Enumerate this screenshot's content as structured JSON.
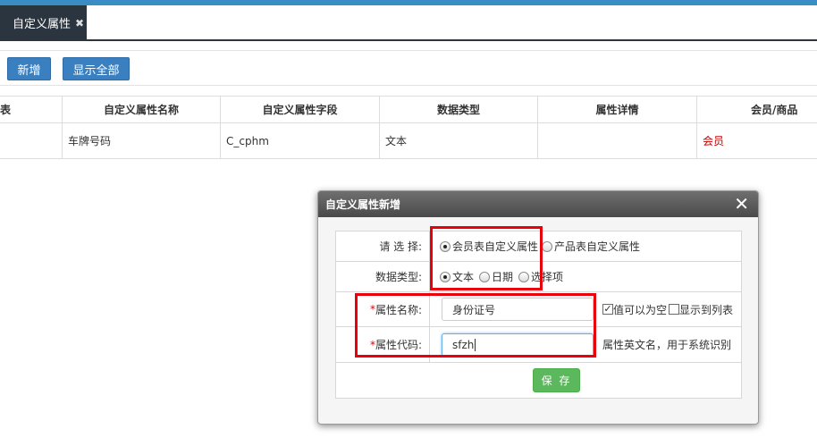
{
  "tab": {
    "label": "自定义属性",
    "close_glyph": "✖"
  },
  "toolbar": {
    "add_label": "新增",
    "show_all_label": "显示全部"
  },
  "table": {
    "columns": [
      "表",
      "自定义属性名称",
      "自定义属性字段",
      "数据类型",
      "属性详情",
      "会员/商品"
    ],
    "rows": [
      {
        "c0": "",
        "name": "车牌号码",
        "field": "C_cphm",
        "type": "文本",
        "detail": "",
        "scope": "会员"
      }
    ]
  },
  "dialog": {
    "title": "自定义属性新增",
    "close_glyph": "✕",
    "select_label": "请 选 择:",
    "select_options": [
      "会员表自定义属性",
      "产品表自定义属性"
    ],
    "select_value": "会员表自定义属性",
    "datatype_label": "数据类型:",
    "datatype_options": [
      "文本",
      "日期",
      "选择项"
    ],
    "datatype_value": "文本",
    "required_mark": "*",
    "name_label": "属性名称:",
    "name_value": "身份证号",
    "nullable_label": "值可以为空",
    "nullable_checked": true,
    "show_in_list_label": "显示到列表",
    "show_in_list_checked": false,
    "code_label": "属性代码:",
    "code_value": "sfzh",
    "code_hint": "属性英文名，用于系统识别",
    "save_label": "保 存"
  },
  "colors": {
    "accent": "#3a8dc4",
    "tab_bg": "#2a3540",
    "button_blue": "#3a7fc0",
    "save_green": "#5cb85c",
    "highlight_red": "#e8000b",
    "member_text": "#c00000"
  }
}
